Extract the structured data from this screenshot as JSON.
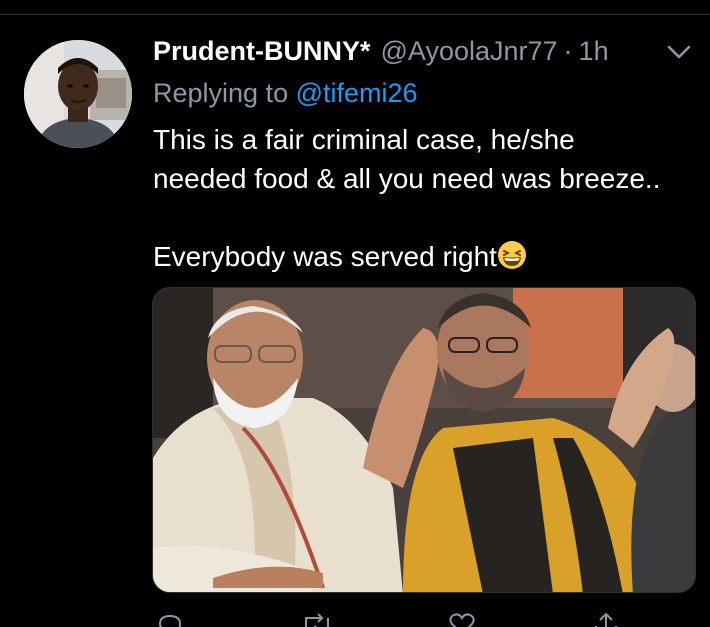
{
  "tweet": {
    "display_name": "Prudent-BUNNY*",
    "handle": "@AyoolaJnr77",
    "separator": "·",
    "time": "1h",
    "reply_prefix": "Replying to",
    "reply_mention": "@tifemi26",
    "text_line_1": "This is a fair criminal case, he/she",
    "text_line_2": "needed food & all you need was breeze..",
    "text_line_3": "Everybody was served right",
    "emoji": "grinning-squinting-face-emoji",
    "avatar_icon": "profile-photo",
    "media_icon": "attached-photo"
  },
  "actions": {
    "icons": [
      "reply-icon",
      "retweet-icon",
      "like-icon",
      "share-icon"
    ]
  },
  "colors": {
    "background": "#000000",
    "text": "#ffffff",
    "secondary_text": "#8b98a5",
    "link": "#1d9bf0",
    "divider": "#2f3336"
  }
}
